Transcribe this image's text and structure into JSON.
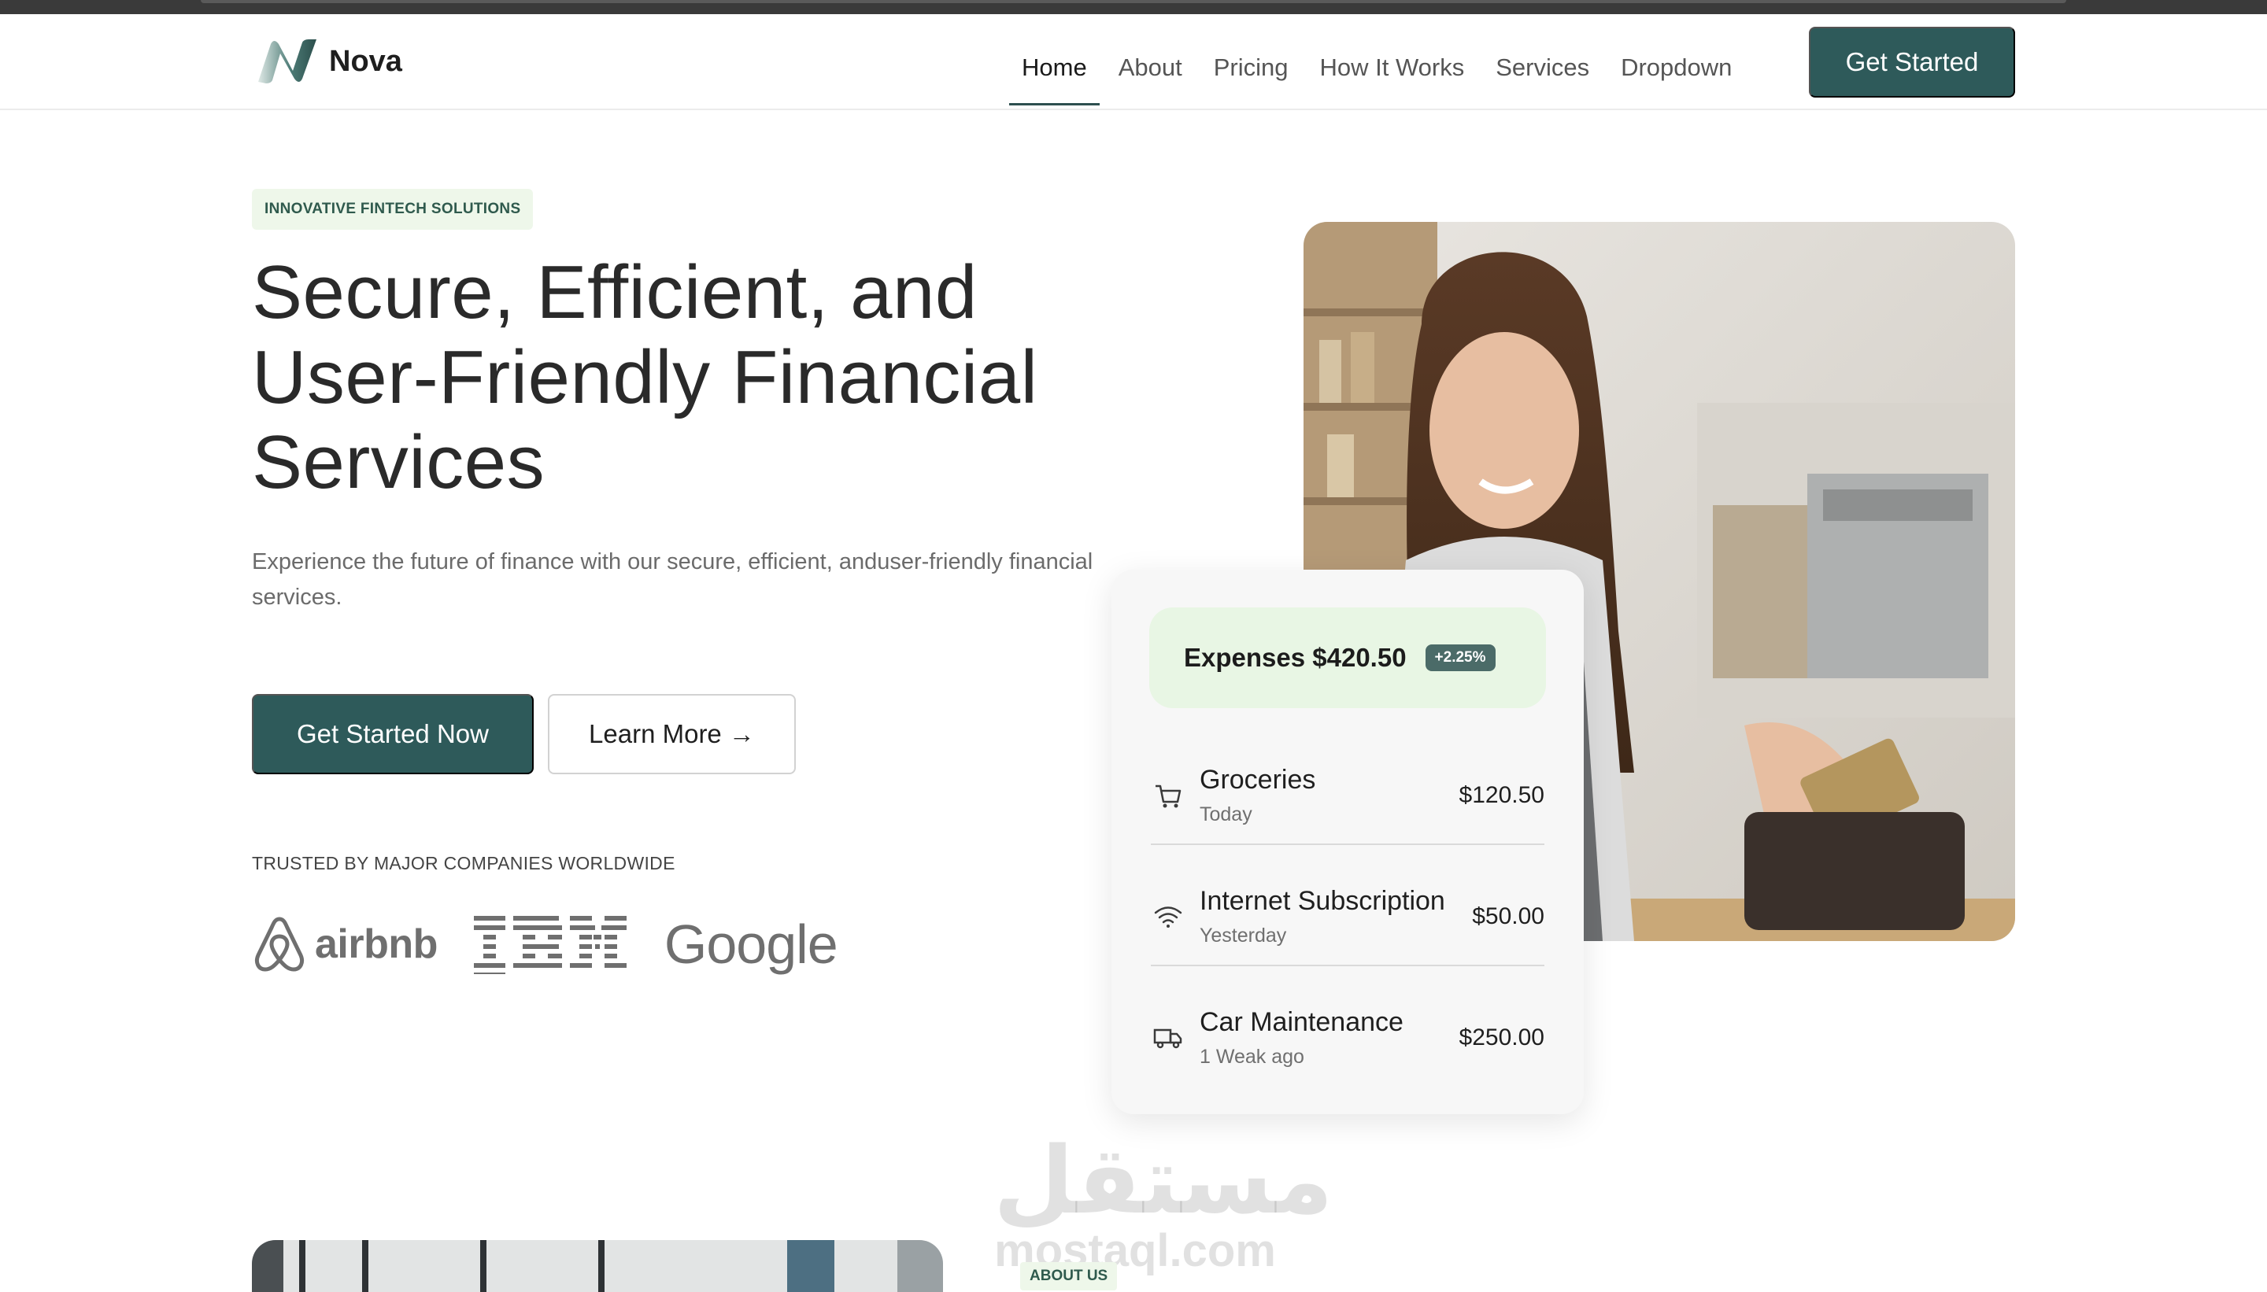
{
  "brand": {
    "name": "Nova",
    "accent": "#2e5a5a"
  },
  "nav": {
    "items": [
      {
        "label": "Home",
        "active": true
      },
      {
        "label": "About"
      },
      {
        "label": "Pricing"
      },
      {
        "label": "How It Works"
      },
      {
        "label": "Services"
      },
      {
        "label": "Dropdown"
      }
    ],
    "cta": "Get Started"
  },
  "hero": {
    "eyebrow": "INNOVATIVE FINTECH SOLUTIONS",
    "title_lines": [
      "Secure, Efficient, and",
      "User-Friendly Financial",
      "Services"
    ],
    "subtitle": "Experience the future of finance with our secure, efficient, anduser-friendly financial services.",
    "primary_button": "Get Started Now",
    "secondary_button": "Learn More →",
    "trusted_label": "TRUSTED BY MAJOR COMPANIES WORLDWIDE",
    "brands": [
      "airbnb",
      "IBM",
      "Google"
    ]
  },
  "expenses": {
    "title": "Expenses $420.50",
    "badge": "+2.25%",
    "items": [
      {
        "name": "Groceries",
        "when": "Today",
        "amount": "$120.50",
        "icon": "cart-icon"
      },
      {
        "name": "Internet Subscription",
        "when": "Yesterday",
        "amount": "$50.00",
        "icon": "wifi-icon"
      },
      {
        "name": "Car Maintenance",
        "when": "1 Weak ago",
        "amount": "$250.00",
        "icon": "truck-icon"
      }
    ]
  },
  "about": {
    "tag": "ABOUT US"
  },
  "watermark": {
    "arabic": "مستقل",
    "latin": "mostaql.com"
  }
}
